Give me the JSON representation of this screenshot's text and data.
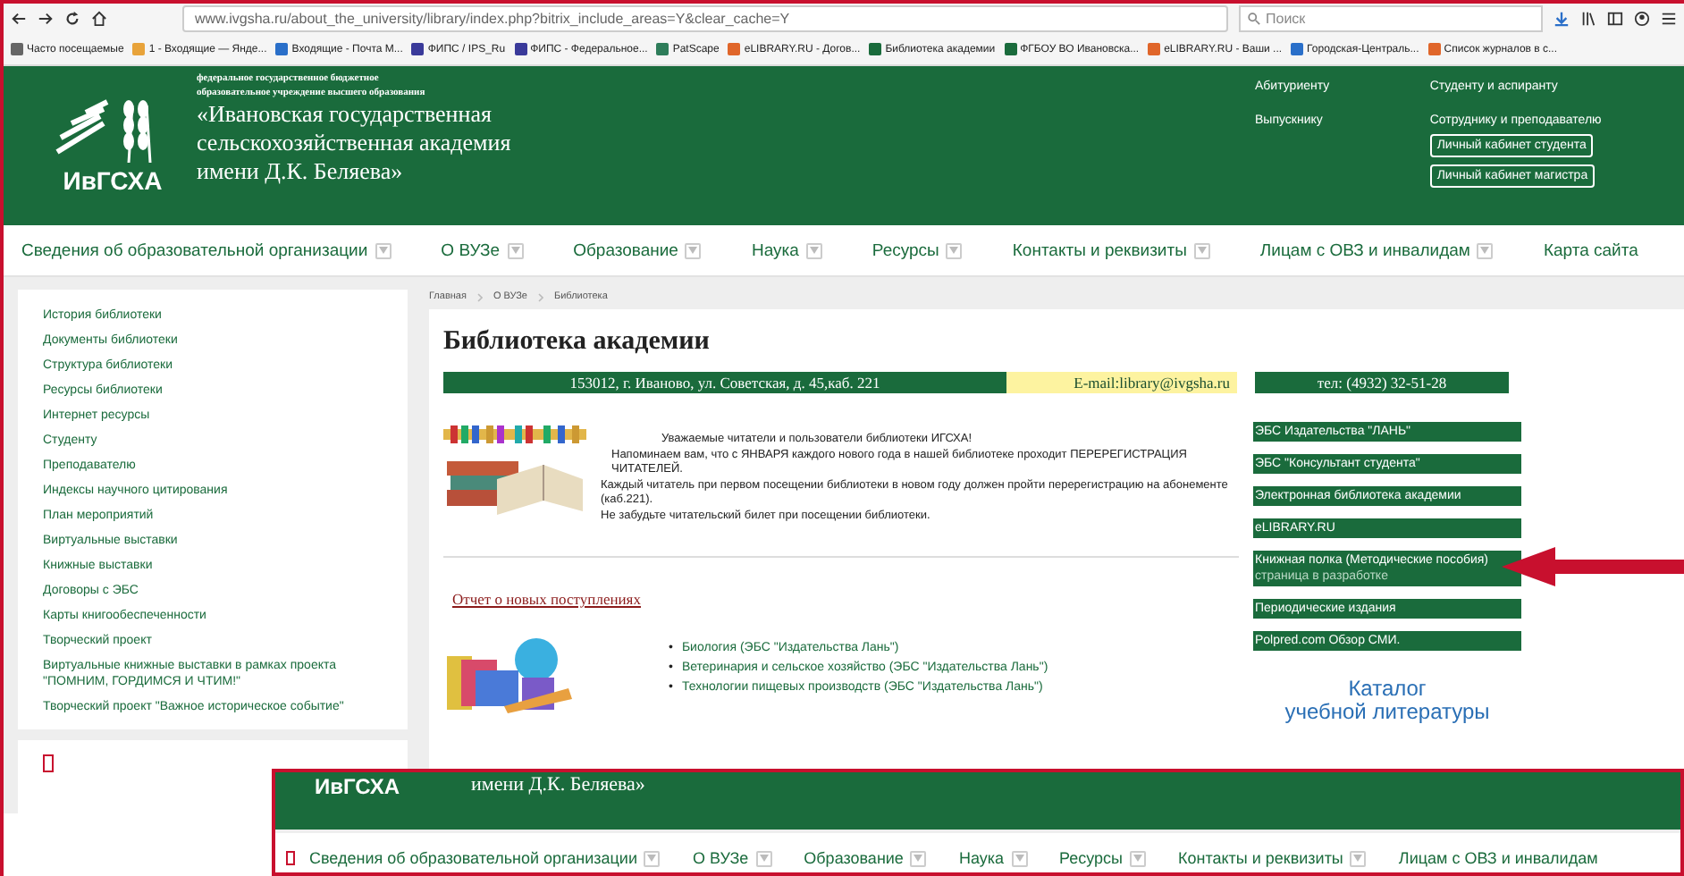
{
  "browser": {
    "url": "www.ivgsha.ru/about_the_university/library/index.php?bitrix_include_areas=Y&clear_cache=Y",
    "search_placeholder": "Поиск",
    "bookmarks": [
      {
        "label": "Часто посещаемые",
        "color": "#666666"
      },
      {
        "label": "1 - Входящие — Янде...",
        "color": "#e8a33a"
      },
      {
        "label": "Входящие - Почта M...",
        "color": "#2a6fc9"
      },
      {
        "label": "ФИПС / IPS_Ru",
        "color": "#3a3a9a"
      },
      {
        "label": "ФИПС - Федеральное...",
        "color": "#3a3a9a"
      },
      {
        "label": "PatScape",
        "color": "#2e7d5a"
      },
      {
        "label": "eLIBRARY.RU - Догов...",
        "color": "#e0662a"
      },
      {
        "label": "Библиотека академии",
        "color": "#1a6b3c"
      },
      {
        "label": "ФГБОУ ВО Ивановска...",
        "color": "#1a6b3c"
      },
      {
        "label": "eLIBRARY.RU - Ваши ...",
        "color": "#e0662a"
      },
      {
        "label": "Городская-Централь...",
        "color": "#2a6fc9"
      },
      {
        "label": "Список журналов в с...",
        "color": "#e0662a"
      }
    ]
  },
  "header": {
    "logo": "ИвГСХА",
    "org_small": [
      "федеральное государственное бюджетное",
      "образовательное учреждение высшего образования"
    ],
    "org_name": [
      "«Ивановская государственная",
      "сельскохозяйственная академия",
      "имени Д.К. Беляева»"
    ],
    "links": [
      "Абитуриенту",
      "Студенту и аспиранту",
      "Выпускнику",
      "Сотруднику и преподавателю"
    ],
    "cabinet_buttons": [
      "Личный кабинет студента",
      "Личный кабинет магистра"
    ]
  },
  "nav": [
    {
      "label": "Сведения об образовательной организации",
      "dropdown": true
    },
    {
      "label": "О ВУЗе",
      "dropdown": true
    },
    {
      "label": "Образование",
      "dropdown": true
    },
    {
      "label": "Наука",
      "dropdown": true
    },
    {
      "label": "Ресурсы",
      "dropdown": true
    },
    {
      "label": "Контакты и реквизиты",
      "dropdown": true
    },
    {
      "label": "Лицам с ОВЗ и инвалидам",
      "dropdown": true
    },
    {
      "label": "Карта сайта",
      "dropdown": false
    }
  ],
  "sidebar": {
    "items": [
      "История библиотеки",
      "Документы библиотеки",
      "Структура библиотеки",
      "Ресурсы библиотеки",
      "Интернет ресурсы",
      "Студенту",
      "Преподавателю",
      "Индексы научного цитирования",
      "План мероприятий",
      "Виртуальные выставки",
      "Книжные выставки",
      "Договоры с ЭБС",
      "Карты книгообеспеченности",
      "Творческий проект",
      "Виртуальные книжные выставки в рамках проекта \"ПОМНИМ, ГОРДИМСЯ И ЧТИМ!\"",
      "Творческий проект \"Важное историческое событие\""
    ]
  },
  "breadcrumbs": [
    "Главная",
    "О ВУЗе",
    "Библиотека"
  ],
  "page": {
    "title": "Библиотека академии",
    "address": "153012, г. Иваново, ул. Советская, д. 45,каб. 221",
    "email": "E-mail:library@ivgsha.ru",
    "phone": "тел: (4932) 32-51-28",
    "notice": [
      "Уважаемые читатели и пользователи библиотеки ИГСХА!",
      "Напоминаем вам, что с ЯНВАРЯ каждого нового года в нашей библиотеке проходит ПЕРЕРЕГИСТРАЦИЯ ЧИТАТЕЛЕЙ.",
      "Каждый читатель при первом посещении библиотеки в новом году должен пройти перерегистрацию на абонементе (каб.221).",
      "Не забудьте читательский билет при посещении библиотеки."
    ],
    "report_link": "Отчет о новых поступлениях",
    "subjects": [
      {
        "marker": "•",
        "label": "Биология (ЭБС \"Издательства Лань\")"
      },
      {
        "marker": "•",
        "label": "Ветеринария и сельское хозяйство (ЭБС \"Издательства Лань\")"
      },
      {
        "marker": "•",
        "label": "Технологии пищевых производств (ЭБС \"Издательства Лань\")"
      }
    ],
    "resource_links": [
      {
        "label": "ЭБС  Издательства \"ЛАНЬ\""
      },
      {
        "label": "ЭБС \"Консультант студента\""
      },
      {
        "label": "Электронная библиотека академии"
      },
      {
        "label": " eLIBRARY.RU"
      },
      {
        "label": "Книжная полка (Методические пособия)",
        "note": "страница в разработке"
      },
      {
        "label": "Периодические издания"
      },
      {
        "label": "Polpred.com Обзор СМИ."
      }
    ],
    "catalog_banner": [
      "Каталог",
      "учебной литературы"
    ]
  },
  "overlay": {
    "logo": "ИвГСХА",
    "org_line": "имени Д.К. Беляева»",
    "nav": [
      {
        "label": "Сведения об образовательной организации",
        "dropdown": true
      },
      {
        "label": "О ВУЗе",
        "dropdown": true
      },
      {
        "label": "Образование",
        "dropdown": true
      },
      {
        "label": "Наука",
        "dropdown": true
      },
      {
        "label": "Ресурсы",
        "dropdown": true
      },
      {
        "label": "Контакты и реквизиты",
        "dropdown": true
      },
      {
        "label": "Лицам с ОВЗ и инвалидам",
        "dropdown": false
      }
    ]
  }
}
